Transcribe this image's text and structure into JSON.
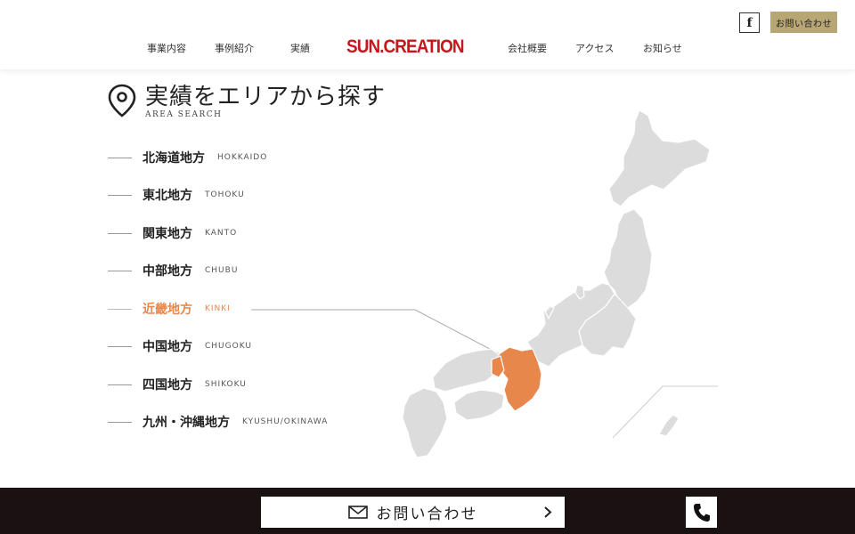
{
  "header": {
    "facebook_label": "f",
    "contact_label": "お問い合わせ",
    "logo": "SUN.CREATION",
    "nav": [
      "事業内容",
      "事例紹介",
      "実績",
      "会社概要",
      "アクセス",
      "お知らせ"
    ]
  },
  "section": {
    "title": "実績をエリアから探す",
    "subtitle": "AREA SEARCH",
    "icon": "map-pin-icon"
  },
  "regions": [
    {
      "jp": "北海道地方",
      "en": "HOKKAIDO"
    },
    {
      "jp": "東北地方",
      "en": "TOHOKU"
    },
    {
      "jp": "関東地方",
      "en": "KANTO"
    },
    {
      "jp": "中部地方",
      "en": "CHUBU"
    },
    {
      "jp": "近畿地方",
      "en": "KINKI"
    },
    {
      "jp": "中国地方",
      "en": "CHUGOKU"
    },
    {
      "jp": "四国地方",
      "en": "SHIKOKU"
    },
    {
      "jp": "九州・沖縄地方",
      "en": "KYUSHU/OKINAWA"
    }
  ],
  "active_region": "KINKI",
  "colors": {
    "accent": "#e8874c",
    "map_gray": "#dcdcdc",
    "logo_red": "#c8161d",
    "gold": "#b8a675",
    "footer_bg": "#1a1212"
  },
  "footer": {
    "contact_label": "お問い合わせ",
    "mail_icon": "mail-icon",
    "chevron_icon": "chevron-right-icon",
    "phone_icon": "phone-icon"
  }
}
